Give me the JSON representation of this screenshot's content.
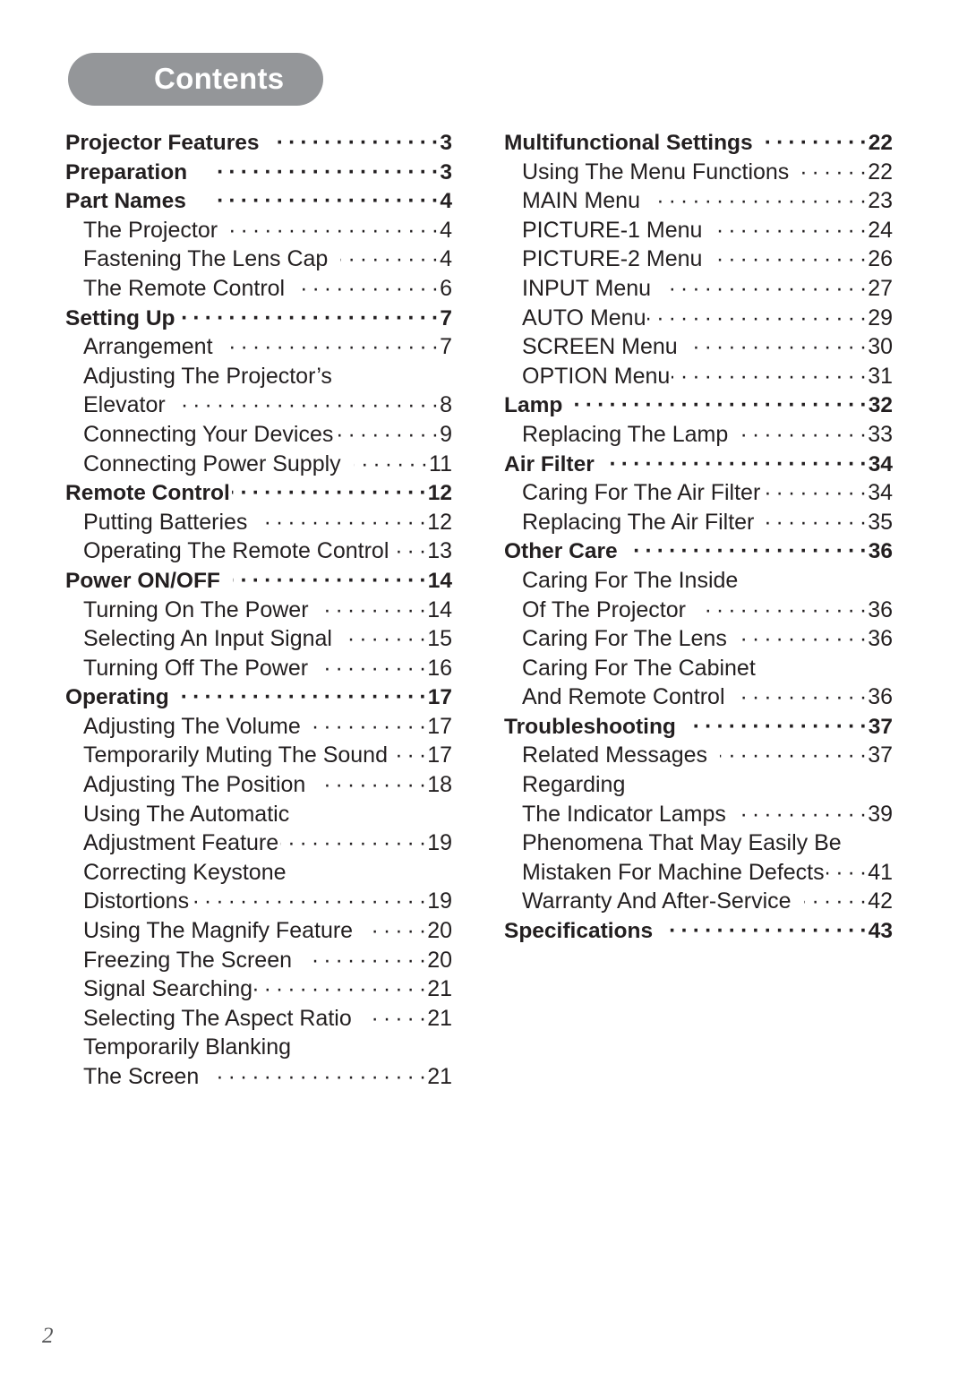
{
  "banner": {
    "title": "Contents",
    "background_color": "#949699",
    "text_color": "#ffffff"
  },
  "folio": {
    "page_number": "2"
  },
  "leader_char": "·",
  "columns": {
    "left": [
      {
        "level": 1,
        "title": "Projector Features",
        "page": "3",
        "gap": 1,
        "nodots": false
      },
      {
        "level": 1,
        "title": "Preparation",
        "page": "3",
        "gap": 2,
        "nodots": false
      },
      {
        "level": 1,
        "title": "Part Names",
        "page": "4",
        "gap": 2,
        "nodots": false
      },
      {
        "level": 2,
        "title": "The Projector",
        "page": "4",
        "gap": 1,
        "nodots": false
      },
      {
        "level": 2,
        "title": "Fastening The Lens Cap",
        "page": "4",
        "gap": 1,
        "nodots": false
      },
      {
        "level": 2,
        "title": "The Remote Control",
        "page": "6",
        "gap": 1,
        "nodots": false
      },
      {
        "level": 1,
        "title": "Setting Up",
        "page": "7",
        "gap": 0,
        "nodots": false
      },
      {
        "level": 2,
        "title": "Arrangement",
        "page": "7",
        "gap": 1,
        "nodots": false
      },
      {
        "level": 2,
        "title": "Adjusting The Projector’s",
        "page": "",
        "gap": 0,
        "nodots": true
      },
      {
        "level": 2,
        "title": "Elevator",
        "page": "8",
        "gap": 1,
        "nodots": false
      },
      {
        "level": 2,
        "title": "Connecting Your Devices",
        "page": "9",
        "gap": 0,
        "nodots": false
      },
      {
        "level": 2,
        "title": "Connecting Power Supply",
        "page": "11",
        "gap": 1,
        "nodots": false
      },
      {
        "level": 1,
        "title": "Remote Control",
        "page": "12",
        "gap": 0,
        "nodots": false
      },
      {
        "level": 2,
        "title": "Putting Batteries",
        "page": "12",
        "gap": 1,
        "nodots": false
      },
      {
        "level": 2,
        "title": "Operating The Remote Control",
        "page": "13",
        "gap": 0,
        "nodots": false
      },
      {
        "level": 1,
        "title": "Power ON/OFF",
        "page": "14",
        "gap": 1,
        "nodots": false
      },
      {
        "level": 2,
        "title": "Turning On The Power",
        "page": "14",
        "gap": 1,
        "nodots": false
      },
      {
        "level": 2,
        "title": "Selecting An Input Signal",
        "page": "15",
        "gap": 1,
        "nodots": false
      },
      {
        "level": 2,
        "title": "Turning Off The Power",
        "page": "16",
        "gap": 1,
        "nodots": false
      },
      {
        "level": 1,
        "title": "Operating",
        "page": "17",
        "gap": 1,
        "nodots": false
      },
      {
        "level": 2,
        "title": "Adjusting The Volume",
        "page": "17",
        "gap": 1,
        "nodots": false
      },
      {
        "level": 2,
        "title": "Temporarily Muting The Sound",
        "page": "17",
        "gap": 0,
        "nodots": false
      },
      {
        "level": 2,
        "title": "Adjusting The Position",
        "page": "18",
        "gap": 1,
        "nodots": false
      },
      {
        "level": 2,
        "title": "Using The Automatic",
        "page": "",
        "gap": 0,
        "nodots": true
      },
      {
        "level": 2,
        "title": "Adjustment Feature",
        "page": "19",
        "gap": 0,
        "nodots": false
      },
      {
        "level": 2,
        "title": "Correcting Keystone",
        "page": "",
        "gap": 0,
        "nodots": true
      },
      {
        "level": 2,
        "title": "Distortions",
        "page": "19",
        "gap": 0,
        "nodots": false
      },
      {
        "level": 2,
        "title": "Using The Magnify Feature",
        "page": "20",
        "gap": 1,
        "nodots": false
      },
      {
        "level": 2,
        "title": "Freezing The Screen",
        "page": "20",
        "gap": 1,
        "nodots": false
      },
      {
        "level": 2,
        "title": "Signal Searching",
        "page": "21",
        "gap": 0,
        "nodots": false
      },
      {
        "level": 2,
        "title": "Selecting The Aspect Ratio",
        "page": "21",
        "gap": 1,
        "nodots": false
      },
      {
        "level": 2,
        "title": "Temporarily Blanking",
        "page": "",
        "gap": 0,
        "nodots": true
      },
      {
        "level": 2,
        "title": "The Screen",
        "page": "21",
        "gap": 1,
        "nodots": false
      }
    ],
    "right": [
      {
        "level": 1,
        "title": "Multifunctional Settings",
        "page": "22",
        "gap": 1,
        "nodots": false
      },
      {
        "level": 2,
        "title": "Using The Menu Functions",
        "page": "22",
        "gap": 1,
        "nodots": false
      },
      {
        "level": 2,
        "title": "MAIN Menu",
        "page": "23",
        "gap": 1,
        "nodots": false
      },
      {
        "level": 2,
        "title": "PICTURE-1 Menu",
        "page": "24",
        "gap": 1,
        "nodots": false
      },
      {
        "level": 2,
        "title": "PICTURE-2 Menu",
        "page": "26",
        "gap": 1,
        "nodots": false
      },
      {
        "level": 2,
        "title": "INPUT Menu",
        "page": "27",
        "gap": 1,
        "nodots": false
      },
      {
        "level": 2,
        "title": "AUTO Menu",
        "page": "29",
        "gap": 0,
        "nodots": false
      },
      {
        "level": 2,
        "title": "SCREEN Menu",
        "page": "30",
        "gap": 1,
        "nodots": false
      },
      {
        "level": 2,
        "title": "OPTION Menu",
        "page": "31",
        "gap": 0,
        "nodots": false
      },
      {
        "level": 1,
        "title": "Lamp",
        "page": "32",
        "gap": 1,
        "nodots": false
      },
      {
        "level": 2,
        "title": "Replacing The Lamp",
        "page": "33",
        "gap": 1,
        "nodots": false
      },
      {
        "level": 1,
        "title": "Air Filter",
        "page": "34",
        "gap": 1,
        "nodots": false
      },
      {
        "level": 2,
        "title": "Caring For The Air Filter",
        "page": "34",
        "gap": 0,
        "nodots": false
      },
      {
        "level": 2,
        "title": "Replacing The Air Filter",
        "page": "35",
        "gap": 1,
        "nodots": false
      },
      {
        "level": 1,
        "title": "Other Care",
        "page": "36",
        "gap": 1,
        "nodots": false
      },
      {
        "level": 2,
        "title": "Caring For The Inside",
        "page": "",
        "gap": 0,
        "nodots": true
      },
      {
        "level": 2,
        "title": "Of The Projector",
        "page": "36",
        "gap": 1,
        "nodots": false
      },
      {
        "level": 2,
        "title": "Caring For The Lens",
        "page": "36",
        "gap": 1,
        "nodots": false
      },
      {
        "level": 2,
        "title": "Caring For The Cabinet",
        "page": "",
        "gap": 0,
        "nodots": true
      },
      {
        "level": 2,
        "title": "And Remote Control",
        "page": "36",
        "gap": 1,
        "nodots": false
      },
      {
        "level": 1,
        "title": "Troubleshooting",
        "page": "37",
        "gap": 1,
        "nodots": false
      },
      {
        "level": 2,
        "title": "Related Messages",
        "page": "37",
        "gap": 1,
        "nodots": false
      },
      {
        "level": 2,
        "title": "Regarding",
        "page": "",
        "gap": 0,
        "nodots": true
      },
      {
        "level": 2,
        "title": "The Indicator Lamps",
        "page": "39",
        "gap": 1,
        "nodots": false
      },
      {
        "level": 2,
        "title": "Phenomena That May Easily Be",
        "page": "",
        "gap": 0,
        "nodots": true
      },
      {
        "level": 2,
        "title": "Mistaken For Machine Defects",
        "page": "41",
        "gap": 0,
        "nodots": false
      },
      {
        "level": 2,
        "title": "Warranty And After-Service",
        "page": "42",
        "gap": 1,
        "nodots": false
      },
      {
        "level": 1,
        "title": "Specifications",
        "page": "43",
        "gap": 1,
        "nodots": false
      }
    ]
  }
}
